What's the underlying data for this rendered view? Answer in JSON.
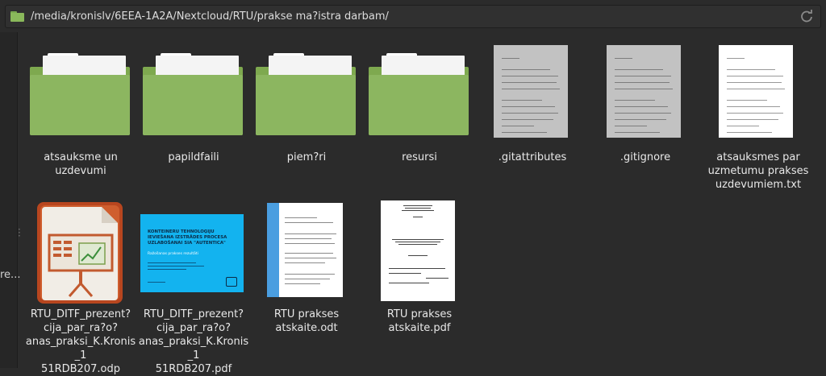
{
  "pathbar": {
    "path": "/media/kronislv/6EEA-1A2A/Nextcloud/RTU/prakse ma?istra darbam/",
    "folder_icon": "folder-icon",
    "reload_icon": "reload-icon"
  },
  "sidebar": {
    "truncated_label": "re..."
  },
  "items": [
    {
      "name": "atsauksme un\nuzdevumi",
      "type": "folder"
    },
    {
      "name": "papildfaili",
      "type": "folder"
    },
    {
      "name": "piem?ri",
      "type": "folder"
    },
    {
      "name": "resursi",
      "type": "folder"
    },
    {
      "name": ".gitattributes",
      "type": "text"
    },
    {
      "name": ".gitignore",
      "type": "text"
    },
    {
      "name": "atsauksmes par\nuzmetumu prakses\nuzdevumiem.txt",
      "type": "text"
    },
    {
      "name": "RTU_DITF_prezent?\ncija_par_ra?o?\nanas_praksi_K.Kronis_1\n51RDB207.odp",
      "type": "odp"
    },
    {
      "name": "RTU_DITF_prezent?\ncija_par_ra?o?\nanas_praksi_K.Kronis_1\n51RDB207.pdf",
      "type": "pdf-slide"
    },
    {
      "name": "RTU prakses\natskaite.odt",
      "type": "odt"
    },
    {
      "name": "RTU prakses\natskaite.pdf",
      "type": "pdf"
    }
  ],
  "slide": {
    "title": "KONTEINERU TEHNOLOĢIJU\nIEVIEŠANA IZSTRĀDES PROCESA\nUZLABOŠANAI SIA \"AUTENTICA\"",
    "subtitle": "Ražošanas prakses rezultāti"
  },
  "colors": {
    "background": "#2b2b2b",
    "folder": "#8cb660",
    "slide_bg": "#13b3ef",
    "impress": "#c5542a"
  }
}
